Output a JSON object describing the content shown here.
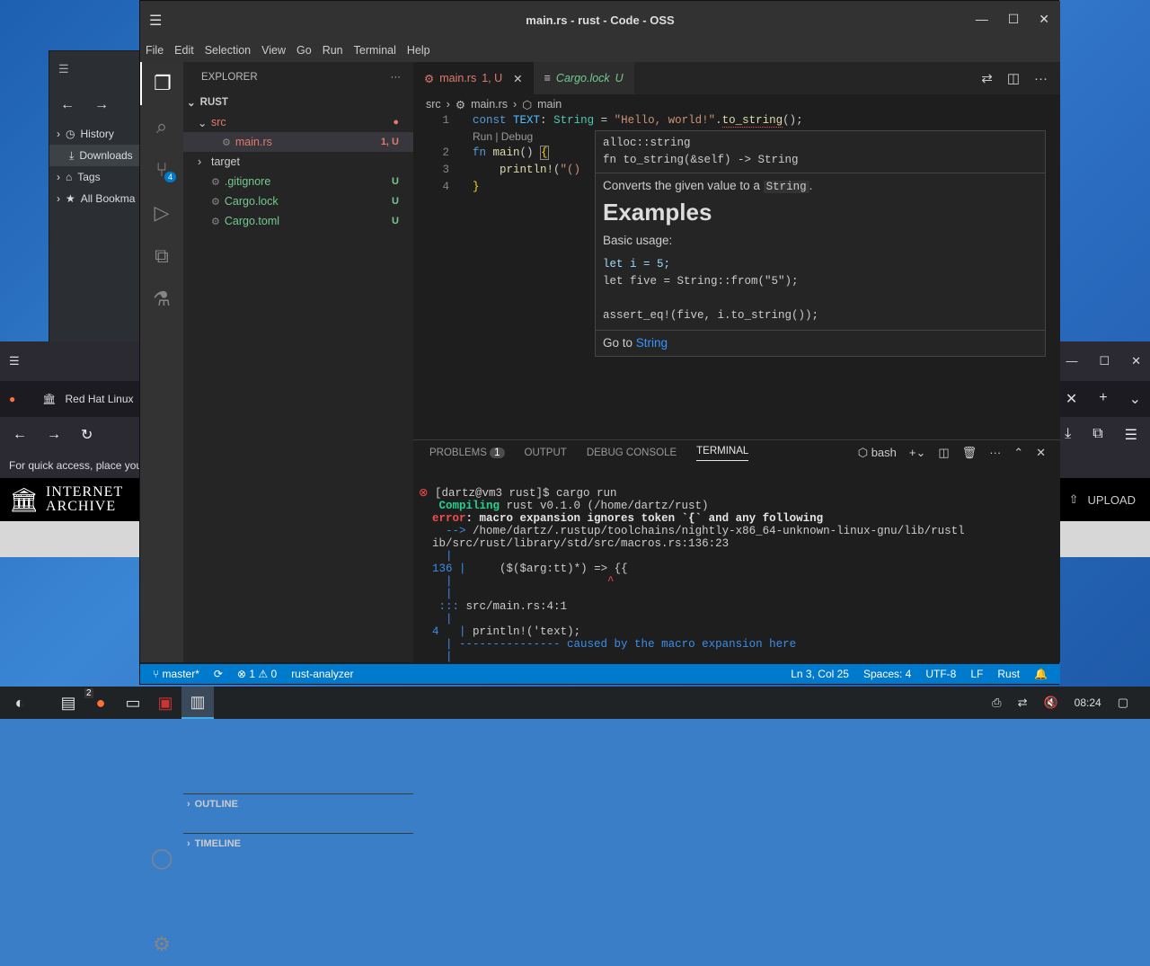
{
  "window": {
    "title": "main.rs - rust - Code - OSS",
    "min": "—",
    "max": "☐",
    "close": "✕",
    "menu": "☰"
  },
  "menu": [
    "File",
    "Edit",
    "Selection",
    "View",
    "Go",
    "Run",
    "Terminal",
    "Help"
  ],
  "activity": {
    "scm_badge": "4"
  },
  "explorer": {
    "title": "EXPLORER",
    "more": "···",
    "root": "RUST",
    "rows": [
      {
        "label": "src",
        "dec": "●",
        "cls": "mod",
        "indent": 1,
        "chev": "⌄"
      },
      {
        "label": "main.rs",
        "dec": "1, U",
        "cls": "mod",
        "indent": 2,
        "chev": ""
      },
      {
        "label": "target",
        "dec": "",
        "cls": "",
        "indent": 1,
        "chev": "›"
      },
      {
        "label": ".gitignore",
        "dec": "U",
        "cls": "git",
        "indent": 1,
        "chev": ""
      },
      {
        "label": "Cargo.lock",
        "dec": "U",
        "cls": "git",
        "indent": 1,
        "chev": ""
      },
      {
        "label": "Cargo.toml",
        "dec": "U",
        "cls": "git",
        "indent": 1,
        "chev": ""
      }
    ],
    "outline": "OUTLINE",
    "timeline": "TIMELINE"
  },
  "tabs": [
    {
      "label": "main.rs",
      "badge": "1, U"
    },
    {
      "label": "Cargo.lock",
      "badge": "U"
    }
  ],
  "breadcrumb": {
    "a": "src",
    "b": "main.rs",
    "c": "main"
  },
  "code": {
    "lines": [
      "1",
      "2",
      "3",
      "4"
    ],
    "codelens": "Run | Debug"
  },
  "hover": {
    "sig1": "alloc::string",
    "sig2": "fn to_string(&self) -> String",
    "desc_pre": "Converts the given value to a ",
    "desc_code": "String",
    "desc_post": ".",
    "heading": "Examples",
    "usage": "Basic usage:",
    "ex1": "let i = 5;",
    "ex2": "let five = String::from(\"5\");",
    "ex3": "assert_eq!(five, i.to_string());",
    "goto": "Go to ",
    "goto_link": "String"
  },
  "panel": {
    "tabs": [
      "PROBLEMS",
      "OUTPUT",
      "DEBUG CONSOLE",
      "TERMINAL"
    ],
    "problems_count": "1",
    "shell": "bash"
  },
  "terminal": {
    "l1": "[dartz@vm3 rust]$ cargo run",
    "l2a": "   Compiling",
    "l2b": " rust v0.1.0 (/home/dartz/rust)",
    "l3a": "error",
    "l3b": ": macro expansion ignores token `{` and any following",
    "l4a": "  -->",
    "l4b": " /home/dartz/.rustup/toolchains/nightly-x86_64-unknown-linux-gnu/lib/rustl",
    "l5": "ib/src/rust/library/std/src/macros.rs:136:23",
    "l6": "    |",
    "l7a": "136",
    "l7b": " |",
    "l7c": "     ($($arg:tt)*) => {{",
    "l8a": "    |",
    "l8b": "                       ^",
    "l9": "    |",
    "l10a": "   :::",
    "l10b": " src/main.rs:4:1",
    "l11": "    |",
    "l12a": "4",
    "l12b": "   |",
    "l12c": " println!('text);",
    "l13a": "    |",
    "l13b": " ---------------",
    "l13c": " caused by the macro expansion here",
    "l14": "    |"
  },
  "status": {
    "branch": "master*",
    "errors": "1",
    "warnings": "0",
    "lsp": "rust-analyzer",
    "pos": "Ln 3, Col 25",
    "spaces": "Spaces: 4",
    "enc": "UTF-8",
    "eol": "LF",
    "lang": "Rust"
  },
  "fm": {
    "items": [
      "History",
      "Downloads",
      "Tags",
      "All Bookma"
    ]
  },
  "browser": {
    "tab": "Red Hat Linux",
    "hint": "For quick access, place you",
    "ia1": "INTERNET",
    "ia2": "ARCHIVE",
    "upload": "UPLOAD"
  },
  "taskbar": {
    "clock": "08:24",
    "ff_badge": "2"
  }
}
